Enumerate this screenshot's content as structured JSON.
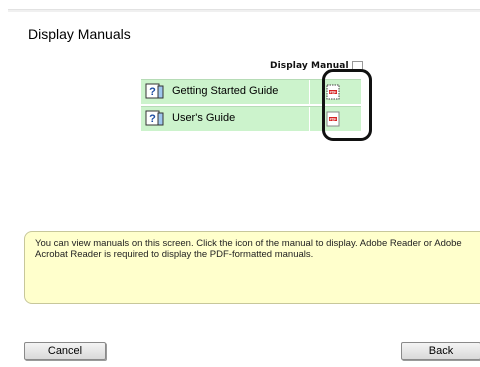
{
  "page": {
    "title": "Display Manuals"
  },
  "manuals_table": {
    "column_header": "Display Manual",
    "header_icon": "document-icon",
    "rows": [
      {
        "label": "Getting Started Guide",
        "icon": "help-book-icon",
        "pdf_icon": "pdf-icon"
      },
      {
        "label": "User's Guide",
        "icon": "help-book-icon",
        "pdf_icon": "pdf-icon"
      }
    ]
  },
  "info": {
    "text": "You can view manuals on this screen. Click the icon of the manual to display. Adobe Reader or Adobe Acrobat Reader is required to display the PDF-formatted manuals."
  },
  "buttons": {
    "cancel": "Cancel",
    "back": "Back"
  },
  "colors": {
    "row_bg": "#ccf3cc",
    "info_bg": "#ffffcc",
    "highlight_ring": "#111111"
  }
}
